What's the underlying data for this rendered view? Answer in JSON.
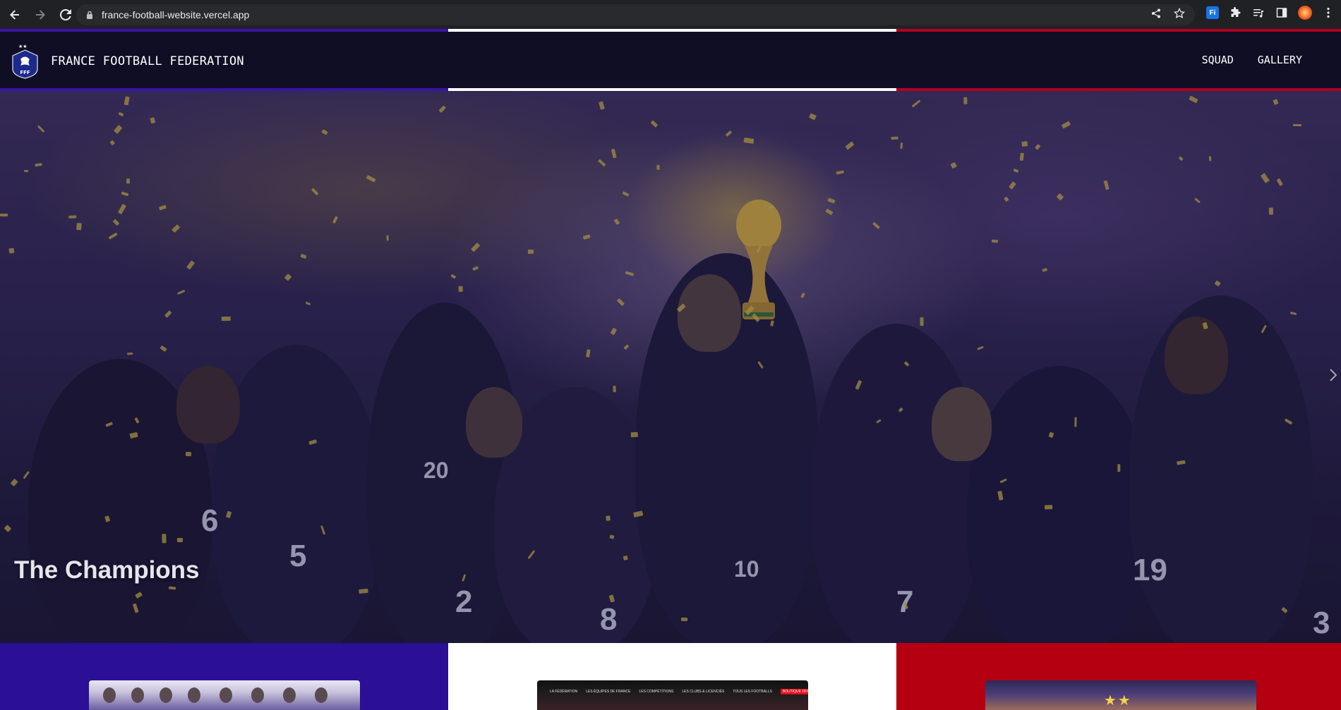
{
  "browser": {
    "url": "france-football-website.vercel.app",
    "extension_label": "Fi"
  },
  "header": {
    "title": "FRANCE FOOTBALL FEDERATION",
    "logo_text": "FFF",
    "nav": [
      "SQUAD",
      "GALLERY"
    ]
  },
  "hero": {
    "caption": "The Champions",
    "jersey_numbers": [
      "6",
      "5",
      "2",
      "8",
      "7",
      "19",
      "3",
      "20",
      "10"
    ]
  },
  "cards": {
    "middle_card_nav": [
      "LA FÉDÉRATION",
      "LES ÉQUIPES DE FRANCE",
      "LES COMPÉTITIONS",
      "LES CLUBS & LICENCIÉS",
      "TOUS LES FOOTBALLS",
      "BOUTIQUE OFFICIELLE"
    ],
    "right_card_stars": "★★"
  },
  "colors": {
    "blue": "#2c0f97",
    "white": "#ffffff",
    "red": "#b50012",
    "header_bg": "#0f0e24"
  }
}
